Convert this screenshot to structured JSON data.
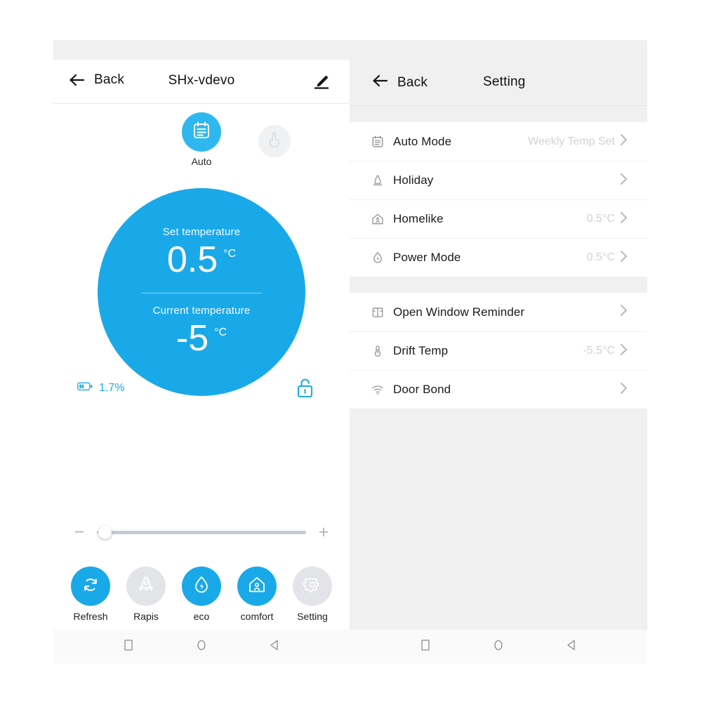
{
  "left_phone": {
    "header": {
      "back_label": "Back",
      "title": "SHx-vdevo",
      "back_icon": "arrow-left-icon",
      "edit_icon": "pencil-edit-icon"
    },
    "mode": {
      "active_label": "Auto",
      "active_icon": "calendar-schedule-icon",
      "disabled_icon": "hand-tap-icon"
    },
    "dial": {
      "set_caption": "Set temperature",
      "set_value": "0.5",
      "set_unit": "°C",
      "current_caption": "Current temperature",
      "current_value": "-5",
      "current_unit": "°C",
      "color": "#1aa9e8"
    },
    "meta": {
      "battery_icon": "battery-icon",
      "battery_text": "1.7%",
      "lock_icon": "lock-open-icon"
    },
    "slider": {
      "minus_label": "−",
      "plus_label": "+",
      "value_percent": 0
    },
    "actions": [
      {
        "label": "Refresh",
        "icon": "refresh-icon",
        "state": "on"
      },
      {
        "label": "Rapis",
        "icon": "rocket-icon",
        "state": "off"
      },
      {
        "label": "eco",
        "icon": "eco-drop-icon",
        "state": "on"
      },
      {
        "label": "comfort",
        "icon": "home-icon",
        "state": "on"
      },
      {
        "label": "Setting",
        "icon": "gear-icon",
        "state": "off"
      }
    ]
  },
  "right_phone": {
    "header": {
      "back_label": "Back",
      "title": "Setting",
      "back_icon": "arrow-left-icon"
    },
    "groups": [
      {
        "rows": [
          {
            "label": "Auto Mode",
            "value": "Weekly Temp Set",
            "icon": "calendar-schedule-icon"
          },
          {
            "label": "Holiday",
            "value": "",
            "icon": "holiday-bell-icon"
          },
          {
            "label": "Homelike",
            "value": "0.5°C",
            "icon": "home-icon"
          },
          {
            "label": "Power Mode",
            "value": "0.5°C",
            "icon": "power-drop-icon"
          }
        ]
      },
      {
        "rows": [
          {
            "label": "Open Window Reminder",
            "value": "",
            "icon": "window-icon"
          },
          {
            "label": "Drift Temp",
            "value": "-5.5°C",
            "icon": "thermometer-icon"
          },
          {
            "label": "Door Bond",
            "value": "",
            "icon": "wifi-icon"
          }
        ]
      }
    ],
    "chevron": "chevron-right-icon"
  },
  "navbar": {
    "buttons": [
      {
        "name": "recents",
        "icon": "square-icon"
      },
      {
        "name": "home",
        "icon": "circle-icon"
      },
      {
        "name": "back",
        "icon": "triangle-back-icon"
      }
    ]
  },
  "colors": {
    "accent": "#1aa9e8",
    "accent_light": "#2fb8f0",
    "disabled": "#e2e4e7",
    "panel_grey": "#f0f0f0"
  }
}
